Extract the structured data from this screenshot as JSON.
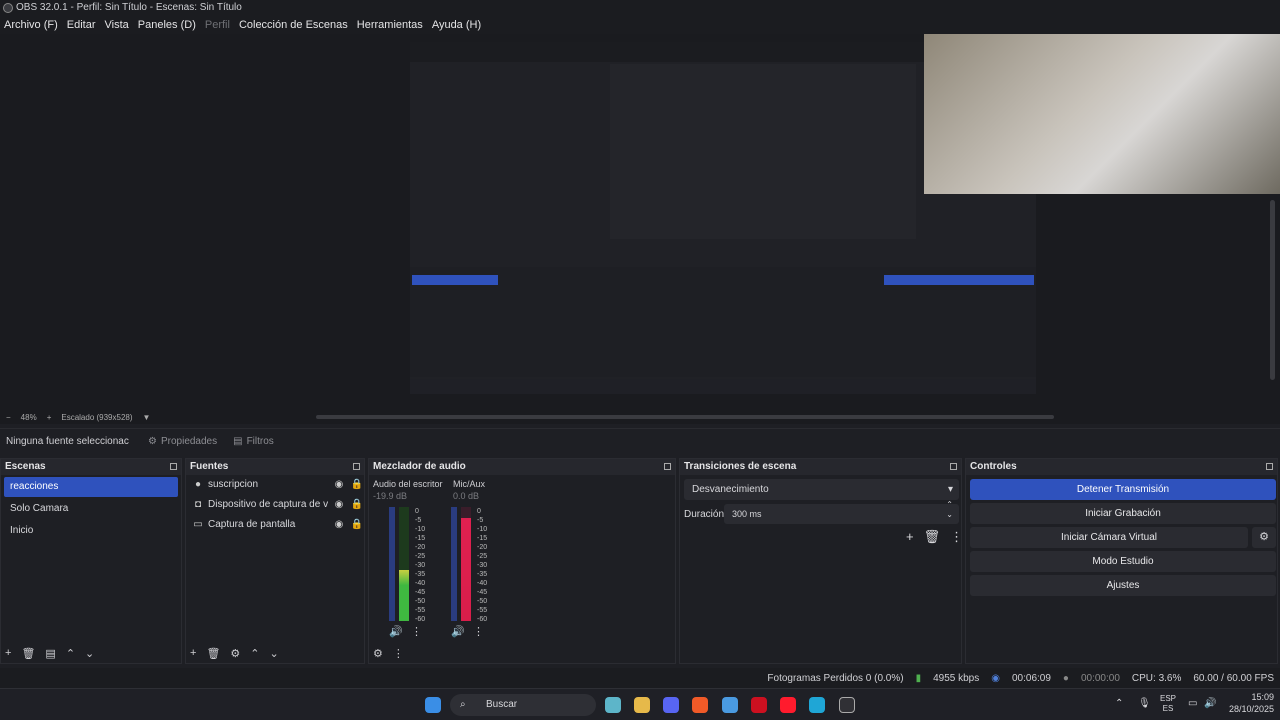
{
  "window": {
    "title": "OBS 32.0.1 - Perfil: Sin Título - Escenas: Sin Título"
  },
  "menu": [
    "Archivo (F)",
    "Editar",
    "Vista",
    "Paneles (D)",
    "Perfil",
    "Colección de Escenas",
    "Herramientas",
    "Ayuda (H)"
  ],
  "preview_bar": {
    "zoom": "48%",
    "scaled": "Escalado (939x528)"
  },
  "source_bar": {
    "selected": "Ninguna fuente seleccionac",
    "properties": "Propiedades",
    "filters": "Filtros"
  },
  "scenes": {
    "title": "Escenas",
    "items": [
      "reacciones",
      "Solo Camara",
      "Inicio"
    ],
    "selected_index": 0
  },
  "sources": {
    "title": "Fuentes",
    "items": [
      {
        "icon": "user-icon",
        "name": "suscripcion"
      },
      {
        "icon": "camera-icon",
        "name": "Dispositivo de captura de vide"
      },
      {
        "icon": "monitor-icon",
        "name": "Captura de pantalla"
      }
    ]
  },
  "mixer": {
    "title": "Mezclador de audio",
    "channels": [
      {
        "name": "Audio del escritorio",
        "db": "-19.9 dB",
        "level": 0.45
      },
      {
        "name": "Mic/Aux",
        "db": "0.0 dB",
        "level": 0.9
      }
    ],
    "ticks": [
      "0",
      "-5",
      "-10",
      "-15",
      "-20",
      "-25",
      "-30",
      "-35",
      "-40",
      "-45",
      "-50",
      "-55",
      "-60"
    ]
  },
  "transitions": {
    "title": "Transiciones de escena",
    "selected": "Desvanecimiento",
    "duration_label": "Duración",
    "duration_value": "300 ms"
  },
  "controls": {
    "title": "Controles",
    "buttons": [
      "Detener Transmisión",
      "Iniciar Grabación",
      "Iniciar Cámara Virtual",
      "Modo Estudio",
      "Ajustes"
    ]
  },
  "status": {
    "dropped": "Fotogramas Perdidos 0 (0.0%)",
    "bitrate": "4955 kbps",
    "stream_time": "00:06:09",
    "rec_time": "00:00:00",
    "cpu": "CPU: 3.6%",
    "fps": "60.00 / 60.00 FPS"
  },
  "taskbar": {
    "search": "Buscar",
    "lang1": "ESP",
    "lang2": "ES",
    "time": "15:09",
    "date": "28/10/2025"
  }
}
